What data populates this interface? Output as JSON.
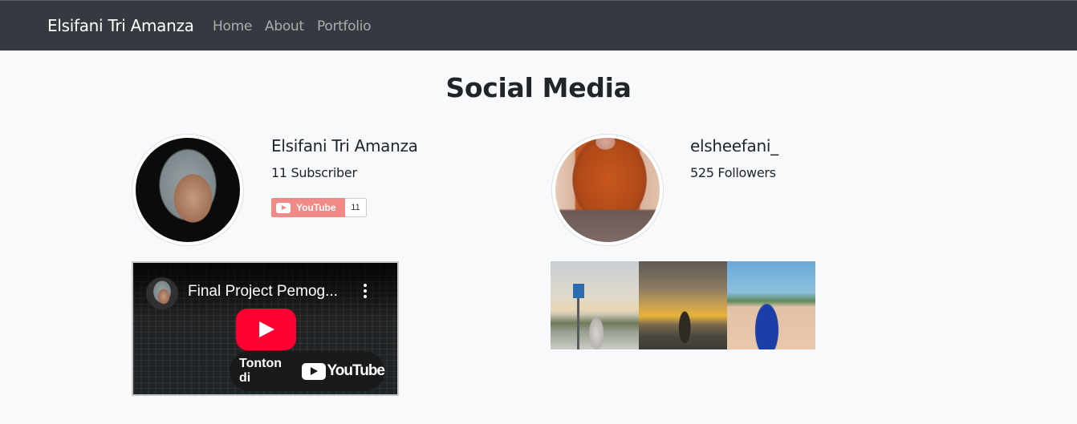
{
  "navbar": {
    "brand": "Elsifani Tri Amanza",
    "links": [
      {
        "label": "Home"
      },
      {
        "label": "About"
      },
      {
        "label": "Portfolio"
      }
    ]
  },
  "page": {
    "title": "Social Media"
  },
  "youtube": {
    "name": "Elsifani Tri Amanza",
    "stat": "11 Subscriber",
    "subscribe_button": {
      "label": "YouTube",
      "count": "11",
      "color": "#ef8a87"
    },
    "video": {
      "title": "Final Project Pemog...",
      "watch_label": "Tonton di",
      "logo_text": "YouTube",
      "play_color": "#ff0033"
    }
  },
  "instagram": {
    "name": "elsheefani_",
    "stat": "525 Followers",
    "photos": [
      {
        "icon": "photo-parking-sign"
      },
      {
        "icon": "photo-beach-sunset"
      },
      {
        "icon": "photo-palm-trees"
      }
    ]
  },
  "colors": {
    "navbar_bg": "#343a40",
    "page_bg": "#f8f9fa",
    "text": "#212529"
  }
}
